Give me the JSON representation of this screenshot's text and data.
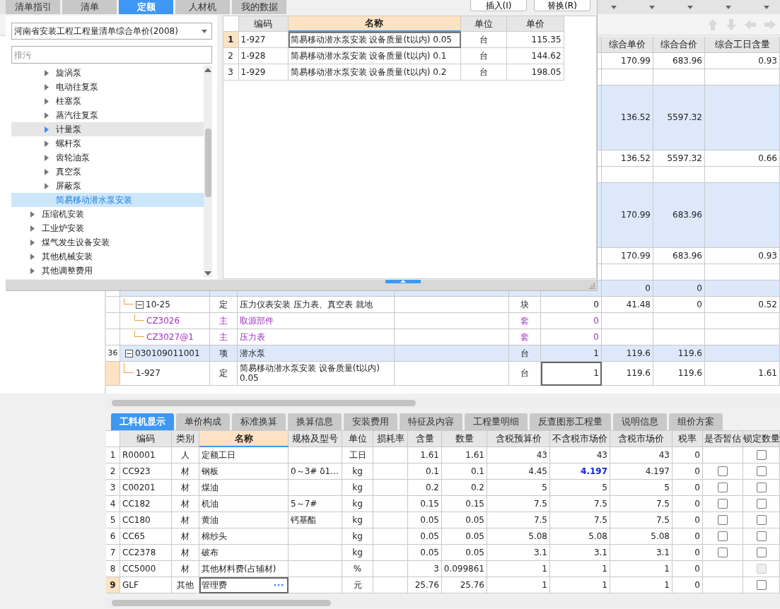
{
  "popup": {
    "tabs": [
      {
        "label": "清单指引",
        "selected": false
      },
      {
        "label": "清单",
        "selected": false
      },
      {
        "label": "定额",
        "selected": true
      },
      {
        "label": "人材机",
        "selected": false
      },
      {
        "label": "我的数据",
        "selected": false
      }
    ],
    "buttons": [
      "插入(I)",
      "替换(R)"
    ],
    "library": "河南省安装工程工程量清单综合单价(2008)",
    "search": {
      "placeholder": "排污"
    },
    "tree": [
      {
        "children": [
          {
            "label": "旋涡泵",
            "expanded": false,
            "hovered": false,
            "selected": false
          },
          {
            "label": "电动往复泵",
            "expanded": false,
            "hovered": false,
            "selected": false
          },
          {
            "label": "柱塞泵",
            "expanded": false,
            "hovered": false,
            "selected": false
          },
          {
            "label": "蒸汽往复泵",
            "expanded": false,
            "hovered": false,
            "selected": false
          },
          {
            "label": "计量泵",
            "expanded": false,
            "hovered": true,
            "selected": false
          },
          {
            "label": "螺杆泵",
            "expanded": false,
            "hovered": false,
            "selected": false
          },
          {
            "label": "齿轮油泵",
            "expanded": false,
            "hovered": false,
            "selected": false
          },
          {
            "label": "真空泵",
            "expanded": false,
            "hovered": false,
            "selected": false
          },
          {
            "label": "屏蔽泵",
            "expanded": false,
            "hovered": false,
            "selected": false
          },
          {
            "label": "简易移动潜水泵安装",
            "hovered": false,
            "selected": true
          }
        ]
      },
      {
        "label": "压缩机安装",
        "expanded": false,
        "hovered": false,
        "selected": false
      },
      {
        "label": "工业炉安装",
        "expanded": false,
        "hovered": false,
        "selected": false
      },
      {
        "label": "煤气发生设备安装",
        "expanded": false,
        "hovered": false,
        "selected": false
      },
      {
        "label": "其他机械安装",
        "expanded": false,
        "hovered": false,
        "selected": false
      },
      {
        "label": "其他调整费用",
        "expanded": false,
        "hovered": false,
        "selected": false
      }
    ],
    "quota_table": {
      "columns": [
        "编码",
        "名称",
        "单位",
        "单价"
      ],
      "rows": [
        {
          "number": "1",
          "code": "1-927",
          "name": "简易移动潜水泵安装 设备质量(t以内) 0.05",
          "unit": "台",
          "price": "115.35",
          "selected": true
        },
        {
          "number": "2",
          "code": "1-928",
          "name": "简易移动潜水泵安装 设备质量(t以内) 0.1",
          "unit": "台",
          "price": "144.62",
          "selected": false
        },
        {
          "number": "3",
          "code": "1-929",
          "name": "简易移动潜水泵安装 设备质量(t以内) 0.2",
          "unit": "台",
          "price": "198.05",
          "selected": false
        }
      ]
    }
  },
  "grid": {
    "columns": [
      "综合单价",
      "综合合价",
      "综合工日含量"
    ],
    "rows": [
      {
        "kind": "quota",
        "unit_price": "170.99",
        "total_price": "683.96",
        "labor": "0.93",
        "selected": false,
        "children": [
          {
            "kind": "main",
            "selected": false
          }
        ]
      },
      {
        "kind": "item",
        "tall": true,
        "unit_price": "136.52",
        "total_price": "5597.32",
        "selected": false,
        "children": [
          {
            "kind": "quota",
            "unit_price": "136.52",
            "total_price": "5597.32",
            "labor": "0.66",
            "selected": false,
            "children": [
              {
                "kind": "main",
                "selected": false
              }
            ]
          }
        ]
      },
      {
        "kind": "item",
        "tall": true,
        "unit_price": "170.99",
        "total_price": "683.96",
        "selected": false,
        "children": [
          {
            "kind": "quota",
            "unit_price": "170.99",
            "total_price": "683.96",
            "labor": "0.93",
            "selected": false,
            "children": [
              {
                "kind": "main",
                "selected": false
              }
            ]
          }
        ]
      },
      {
        "kind": "item",
        "unit_price": "0",
        "total_price": "0",
        "selected": false,
        "children": [
          {
            "kind": "quota",
            "code": "10-25",
            "expanded": true,
            "type": "定",
            "name": "压力仪表安装 压力表、真空表 就地",
            "unit": "块",
            "quantity": "0",
            "unit_price": "41.48",
            "total_price": "0",
            "labor": "0.52",
            "selected": false,
            "children": [
              {
                "kind": "main",
                "code": "CZ3026",
                "type": "主",
                "name": "取源部件",
                "unit": "套",
                "quantity": "0",
                "selected": false
              },
              {
                "kind": "main",
                "code": "CZ3027@1",
                "type": "主",
                "name": "压力表",
                "unit": "套",
                "quantity": "0",
                "selected": false
              }
            ]
          }
        ]
      },
      {
        "kind": "item",
        "number": "36",
        "code": "030109011001",
        "expanded": true,
        "type": "项",
        "name": "潜水泵",
        "unit": "台",
        "quantity": "1",
        "unit_price": "119.6",
        "total_price": "119.6",
        "selected": false,
        "children": [
          {
            "kind": "quota",
            "code": "1-927",
            "type": "定",
            "name": "简易移动潜水泵安装 设备质量(t以内) 0.05",
            "unit": "台",
            "quantity": "1",
            "unit_price": "119.6",
            "total_price": "119.6",
            "labor": "1.61",
            "selected": true
          }
        ]
      }
    ]
  },
  "detail_tabs": [
    {
      "label": "工料机显示",
      "selected": true
    },
    {
      "label": "单价构成",
      "selected": false
    },
    {
      "label": "标准换算",
      "selected": false
    },
    {
      "label": "换算信息",
      "selected": false
    },
    {
      "label": "安装费用",
      "selected": false
    },
    {
      "label": "特征及内容",
      "selected": false
    },
    {
      "label": "工程量明细",
      "selected": false
    },
    {
      "label": "反查图形工程量",
      "selected": false
    },
    {
      "label": "说明信息",
      "selected": false
    },
    {
      "label": "组价方案",
      "selected": false
    }
  ],
  "detail_table": {
    "columns": [
      "编码",
      "类别",
      "名称",
      "规格及型号",
      "单位",
      "损耗率",
      "含量",
      "数量",
      "含税预算价",
      "不含税市场价",
      "含税市场价",
      "税率",
      "是否暂估",
      "锁定数量"
    ],
    "rows": [
      {
        "number": "1",
        "code": "R00001",
        "type": "人",
        "name": "定额工日",
        "unit": "工日",
        "content": "1.61",
        "quantity": "1.61",
        "budget_price": "43",
        "market_price": "43",
        "market_price_tax": "43",
        "tax_rate": "0",
        "locked": false,
        "selected": false
      },
      {
        "number": "2",
        "code": "CC923",
        "type": "材",
        "name": "钢板",
        "spec": "0～3# δ1…",
        "unit": "kg",
        "content": "0.1",
        "quantity": "0.1",
        "budget_price": "4.45",
        "market_price": "4.197",
        "market_price_changed": true,
        "market_price_tax": "4.197",
        "tax_rate": "0",
        "provisional": false,
        "locked": false,
        "selected": false
      },
      {
        "number": "3",
        "code": "C00201",
        "type": "材",
        "name": "煤油",
        "unit": "kg",
        "content": "0.2",
        "quantity": "0.2",
        "budget_price": "5",
        "market_price": "5",
        "market_price_tax": "5",
        "tax_rate": "0",
        "provisional": false,
        "locked": false,
        "selected": false
      },
      {
        "number": "4",
        "code": "CC182",
        "type": "材",
        "name": "机油",
        "spec": "5～7#",
        "unit": "kg",
        "content": "0.15",
        "quantity": "0.15",
        "budget_price": "7.5",
        "market_price": "7.5",
        "market_price_tax": "7.5",
        "tax_rate": "0",
        "provisional": false,
        "locked": false,
        "selected": false
      },
      {
        "number": "5",
        "code": "CC180",
        "type": "材",
        "name": "黄油",
        "spec": "钙基酯",
        "unit": "kg",
        "content": "0.05",
        "quantity": "0.05",
        "budget_price": "7.5",
        "market_price": "7.5",
        "market_price_tax": "7.5",
        "tax_rate": "0",
        "provisional": false,
        "locked": false,
        "selected": false
      },
      {
        "number": "6",
        "code": "CC65",
        "type": "材",
        "name": "棉纱头",
        "unit": "kg",
        "content": "0.05",
        "quantity": "0.05",
        "budget_price": "5.08",
        "market_price": "5.08",
        "market_price_tax": "5.08",
        "tax_rate": "0",
        "provisional": false,
        "locked": false,
        "selected": false
      },
      {
        "number": "7",
        "code": "CC2378",
        "type": "材",
        "name": "破布",
        "unit": "kg",
        "content": "0.05",
        "quantity": "0.05",
        "budget_price": "3.1",
        "market_price": "3.1",
        "market_price_tax": "3.1",
        "tax_rate": "0",
        "provisional": false,
        "locked": false,
        "selected": false
      },
      {
        "number": "8",
        "code": "CC5000",
        "type": "材",
        "name": "其他材料费(占辅材)",
        "unit": "%",
        "content": "3",
        "quantity": "0.099861",
        "budget_price": "1",
        "market_price": "1",
        "market_price_tax": "1",
        "tax_rate": "0",
        "locked": false,
        "lock_disabled": true,
        "selected": false
      },
      {
        "number": "9",
        "code": "GLF",
        "type": "其他",
        "name": "管理费",
        "unit": "元",
        "content": "25.76",
        "quantity": "25.76",
        "budget_price": "1",
        "market_price": "1",
        "market_price_tax": "1",
        "tax_rate": "0",
        "locked": false,
        "selected": true
      }
    ]
  }
}
